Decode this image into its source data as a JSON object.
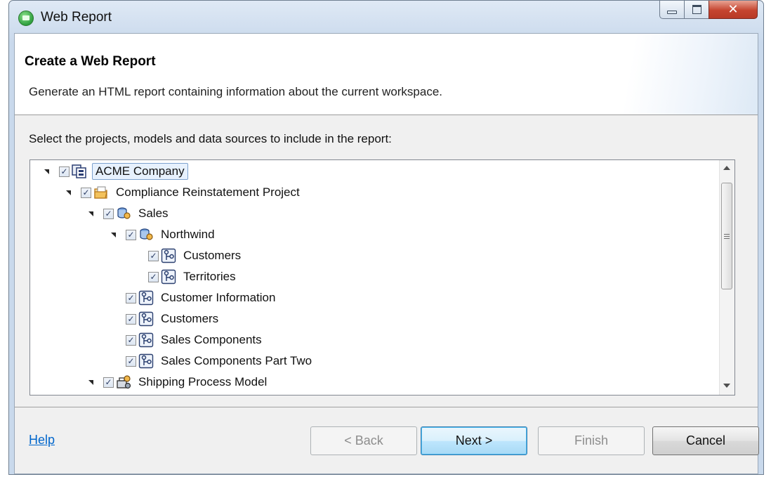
{
  "window": {
    "title": "Web Report"
  },
  "header": {
    "title": "Create a Web Report",
    "description": "Generate an HTML report containing information about the current workspace."
  },
  "tree": {
    "label": "Select the projects, models and data sources to include in the report:",
    "nodes": [
      {
        "label": "ACME Company",
        "icon": "workspace-icon",
        "expanded": true,
        "checked": true,
        "selected": true
      },
      {
        "label": "Compliance Reinstatement Project",
        "icon": "project-folder-icon",
        "expanded": true,
        "checked": true
      },
      {
        "label": "Sales",
        "icon": "data-source-icon",
        "expanded": true,
        "checked": true
      },
      {
        "label": "Northwind",
        "icon": "data-source-icon",
        "expanded": true,
        "checked": true
      },
      {
        "label": "Customers",
        "icon": "model-icon",
        "checked": true
      },
      {
        "label": "Territories",
        "icon": "model-icon",
        "checked": true
      },
      {
        "label": "Customer Information",
        "icon": "model-icon",
        "checked": true
      },
      {
        "label": "Customers",
        "icon": "model-icon",
        "checked": true
      },
      {
        "label": "Sales Components",
        "icon": "model-icon",
        "checked": true
      },
      {
        "label": "Sales Components Part Two",
        "icon": "model-icon",
        "checked": true
      },
      {
        "label": "Shipping Process Model",
        "icon": "process-model-icon",
        "expanded": true,
        "checked": true
      }
    ]
  },
  "footer": {
    "help": "Help",
    "back": "< Back",
    "next": "Next >",
    "finish": "Finish",
    "cancel": "Cancel"
  },
  "colors": {
    "link": "#0066cc",
    "selection": "#e7f1fd",
    "default_button": "#bee6fd"
  }
}
